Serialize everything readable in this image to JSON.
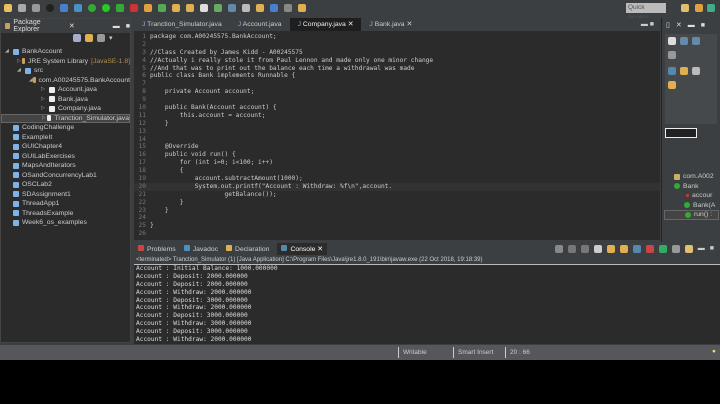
{
  "toolbar": {
    "quick_access": "Quick Access"
  },
  "package_explorer": {
    "title": "Package Explorer",
    "items": [
      {
        "label": "BankAccount",
        "indent": 0,
        "icon": "project"
      },
      {
        "label": "JRE System Library",
        "extra": "[JavaSE-1.8]",
        "indent": 1,
        "icon": "library"
      },
      {
        "label": "src",
        "indent": 1,
        "icon": "folder"
      },
      {
        "label": "com.A00245575.BankAccount",
        "indent": 2,
        "icon": "package"
      },
      {
        "label": "Account.java",
        "indent": 3,
        "icon": "java"
      },
      {
        "label": "Bank.java",
        "indent": 3,
        "icon": "java"
      },
      {
        "label": "Company.java",
        "indent": 3,
        "icon": "java"
      },
      {
        "label": "Tranction_Simulator.java",
        "indent": 3,
        "icon": "java",
        "selected": true
      },
      {
        "label": "CodingChallenge",
        "indent": 0,
        "icon": "folder"
      },
      {
        "label": "ExampleIt",
        "indent": 0,
        "icon": "folder"
      },
      {
        "label": "GUIChapter4",
        "indent": 0,
        "icon": "folder"
      },
      {
        "label": "GUILabExercises",
        "indent": 0,
        "icon": "folder"
      },
      {
        "label": "MapsAndIterators",
        "indent": 0,
        "icon": "folder"
      },
      {
        "label": "OSandConcurrencyLab1",
        "indent": 0,
        "icon": "folder"
      },
      {
        "label": "OSCLab2",
        "indent": 0,
        "icon": "folder"
      },
      {
        "label": "SDAssignment1",
        "indent": 0,
        "icon": "folder"
      },
      {
        "label": "ThreadApp1",
        "indent": 0,
        "icon": "folder"
      },
      {
        "label": "ThreadsExample",
        "indent": 0,
        "icon": "folder"
      },
      {
        "label": "Week6_os_examples",
        "indent": 0,
        "icon": "folder"
      }
    ]
  },
  "editor": {
    "tabs": [
      "Tranction_Simulator.java",
      "Account.java",
      "Company.java",
      "Bank.java"
    ],
    "active_tab": 2,
    "lines": [
      "package com.A00245575.BankAccount;",
      "",
      "//Class Created by James Kidd - A00245575",
      "//Actually i really stole it from Paul Lennon and made only one minor change",
      "//And that was to print out the balance each time a withdrawal was made",
      "public class Bank implements Runnable {",
      "",
      "    private Account account;",
      "",
      "    public Bank(Account account) {",
      "        this.account = account;",
      "    }",
      "",
      "",
      "    @Override",
      "    public void run() {",
      "        for (int i=0; i<100; i++)",
      "        {",
      "            account.subtractAmount(1000);",
      "            System.out.printf(\"Account : Withdraw: %f\\n\",account.",
      "                    getBalance());",
      "        }",
      "    }",
      "",
      "}",
      ""
    ]
  },
  "outline": {
    "items": [
      "com.A002",
      "Bank",
      "accour",
      "Bank(A",
      "run() :"
    ]
  },
  "console": {
    "tabs": [
      "Problems",
      "Javadoc",
      "Declaration",
      "Console"
    ],
    "header": "<terminated> Tranction_Simulator (1) [Java Application] C:\\Program Files\\Java\\jre1.8.0_191\\bin\\javaw.exe (22 Oct 2018, 19:18:39)",
    "lines": [
      "Account : Initial Balance: 1000.000000",
      "Account : Deposit: 2000.000000",
      "Account : Deposit: 2000.000000",
      "Account : Withdraw: 2000.000000",
      "Account : Deposit: 3000.000000",
      "Account : Withdraw: 2000.000000",
      "Account : Deposit: 3000.000000",
      "Account : Withdraw: 3000.000000",
      "Account : Deposit: 3000.000000",
      "Account : Withdraw: 2000.000000"
    ]
  },
  "status": {
    "writable": "Writable",
    "insert": "Smart Insert",
    "position": "20 : 66"
  }
}
